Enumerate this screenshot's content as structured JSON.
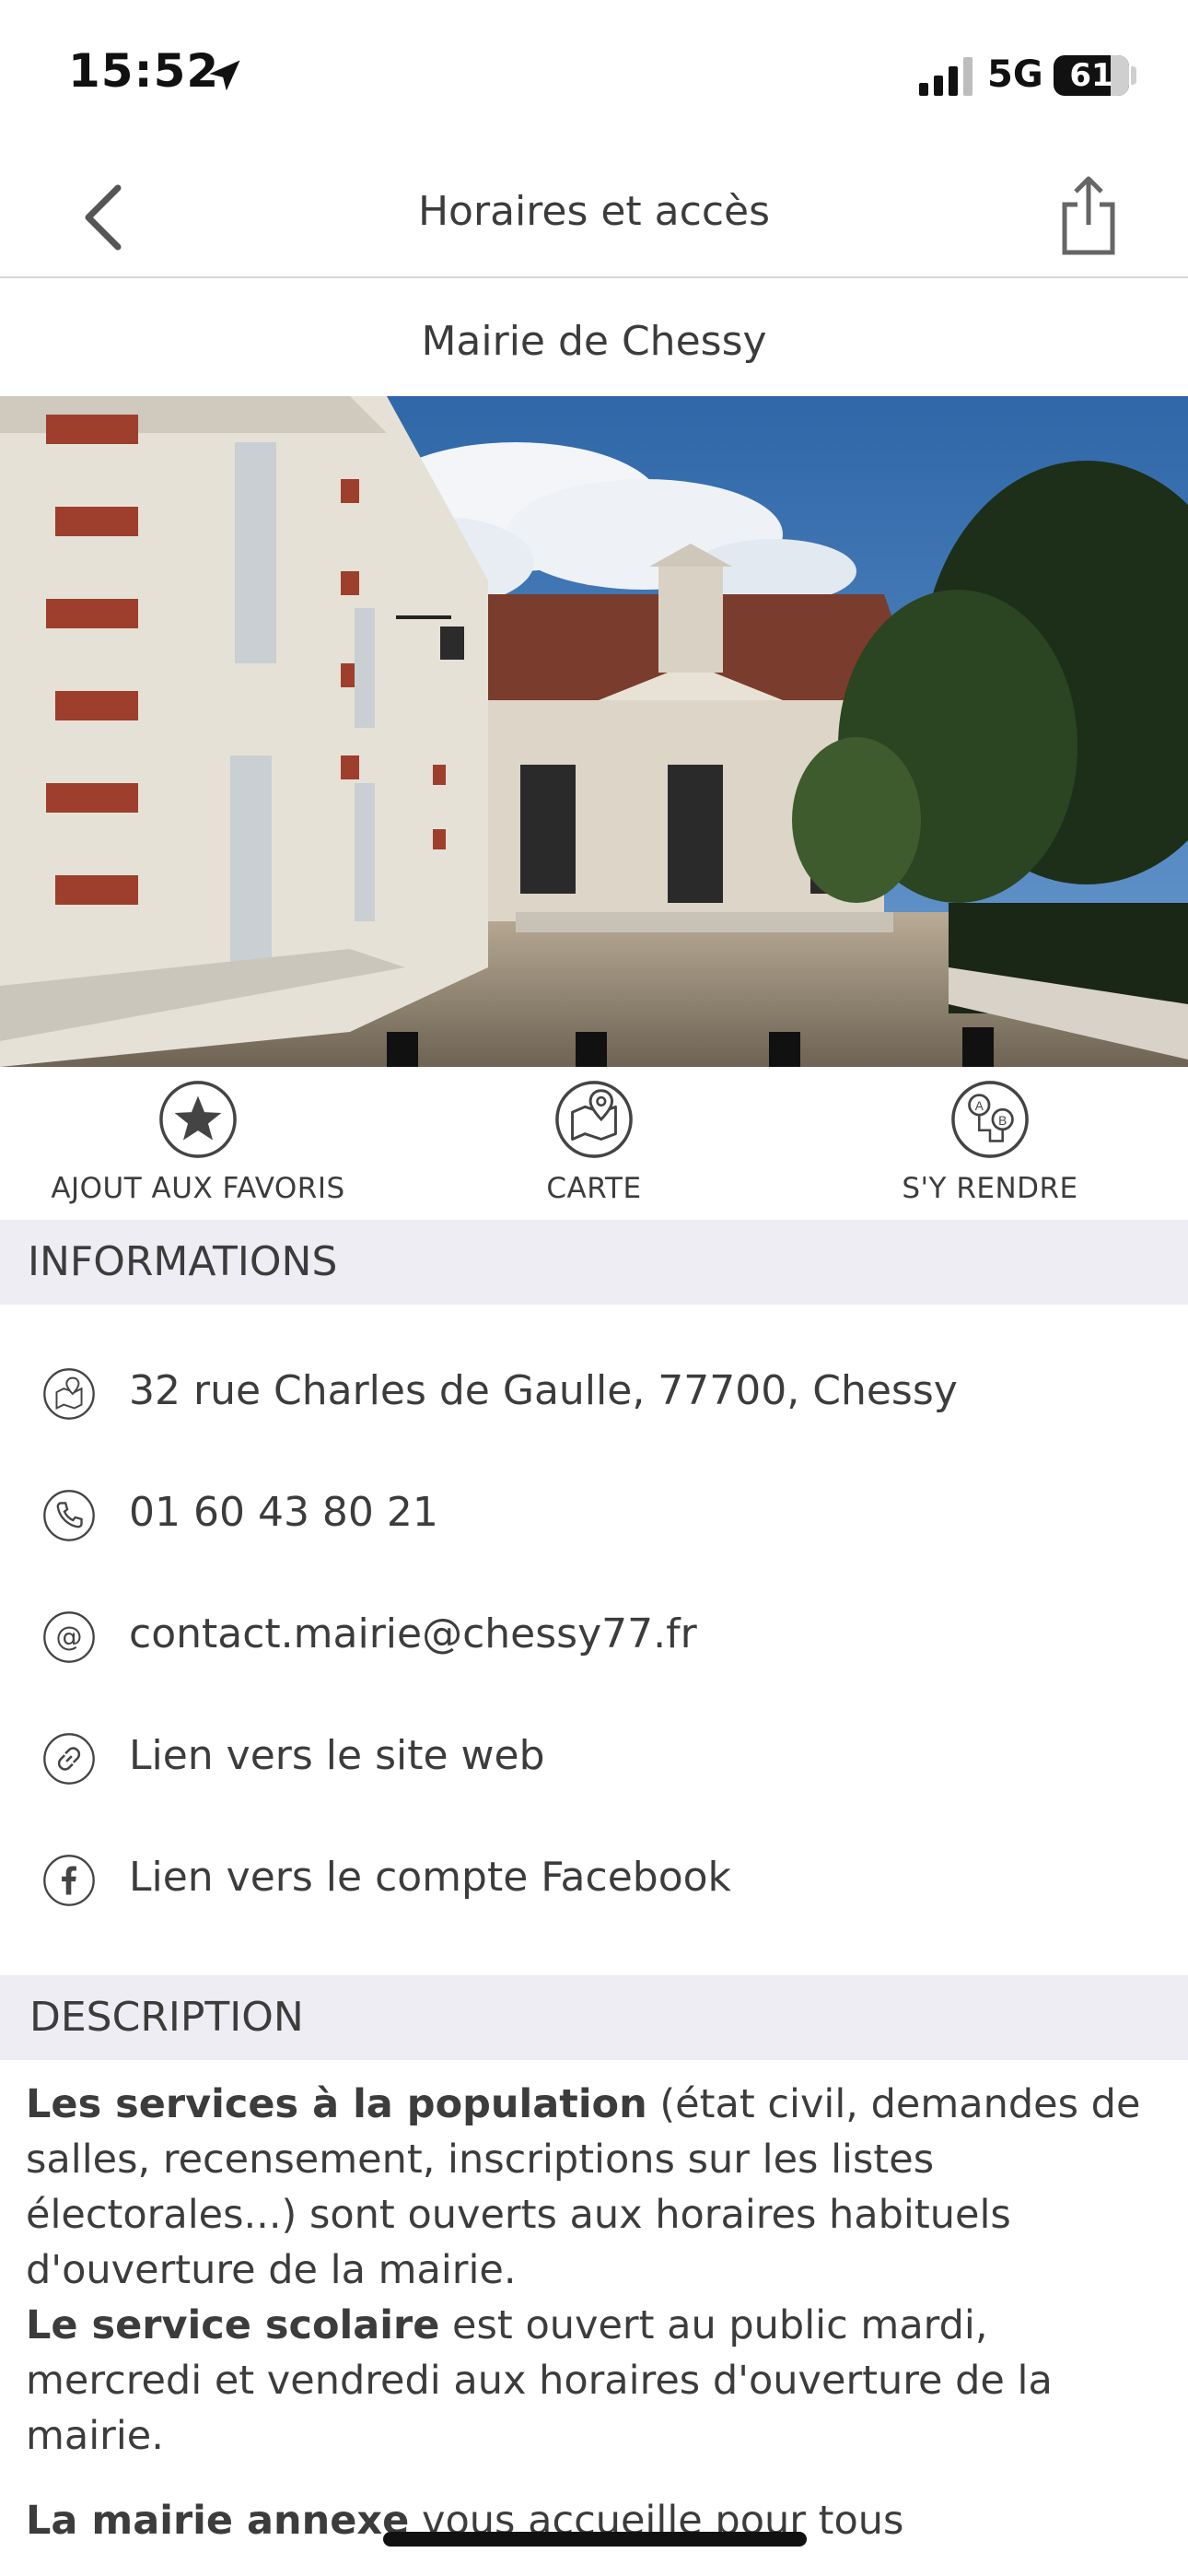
{
  "status_bar": {
    "time": "15:52",
    "network": "5G",
    "battery": "61",
    "icons": [
      "location-arrow-icon",
      "signal-icon",
      "battery-icon"
    ]
  },
  "nav": {
    "title": "Horaires et accès",
    "back_icon": "chevron-left-icon",
    "share_icon": "share-icon"
  },
  "place": {
    "name": "Mairie de Chessy"
  },
  "actions": [
    {
      "label": "AJOUT AUX FAVORIS",
      "icon": "star-icon"
    },
    {
      "label": "CARTE",
      "icon": "map-icon"
    },
    {
      "label": "S'Y RENDRE",
      "icon": "route-icon"
    }
  ],
  "informations": {
    "header": "INFORMATIONS",
    "items": [
      {
        "icon": "map-pin-icon",
        "text": "32 rue Charles de Gaulle, 77700, Chessy"
      },
      {
        "icon": "phone-icon",
        "text": "01 60 43 80 21"
      },
      {
        "icon": "at-icon",
        "text": "contact.mairie@chessy77.fr"
      },
      {
        "icon": "link-icon",
        "text": "Lien vers le site web"
      },
      {
        "icon": "facebook-icon",
        "text": "Lien vers le compte Facebook"
      }
    ]
  },
  "description": {
    "header": "DESCRIPTION",
    "p1_bold": "Les services à la population",
    "p1_rest": " (état civil, demandes de salles, recensement, inscriptions sur les listes électorales...) sont ouverts aux horaires habituels d'ouverture de la mairie.",
    "p2_bold": "Le service scolaire",
    "p2_rest": " est ouvert au public mardi, mercredi et vendredi aux horaires d'ouverture de la mairie.",
    "p3_bold": "La mairie annexe",
    "p3_rest": " vous accueille pour tous"
  },
  "colors": {
    "text": "#3c3c3c",
    "section_bg": "#ededf3",
    "divider": "#d6d6d6"
  }
}
